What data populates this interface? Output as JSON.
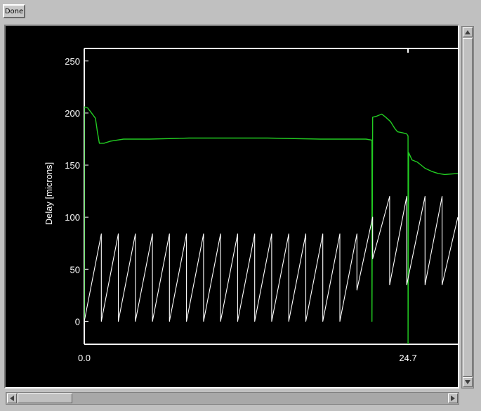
{
  "toolbar": {
    "done_label": "Done"
  },
  "colors": {
    "plot_bg": "#000000",
    "axis": "#ffffff",
    "green_series": "#22cc22",
    "white_series": "#ffffff"
  },
  "chart_data": {
    "type": "line",
    "ylabel": "Delay [microns]",
    "xlabel": "",
    "title": "",
    "ylim": [
      -22,
      262
    ],
    "yticks": [
      0,
      50,
      100,
      150,
      200,
      250
    ],
    "ytick_labels": [
      "0",
      "50",
      "100",
      "150",
      "200",
      "250"
    ],
    "xlim": [
      0,
      28.5
    ],
    "xtick_labels": [
      {
        "x": 0,
        "label": "0.0"
      },
      {
        "x": 24.7,
        "label": "24.7"
      }
    ],
    "grid": false,
    "legend": "none",
    "series": [
      {
        "color": "#22cc22",
        "points": [
          [
            0.0,
            0
          ],
          [
            0.0,
            206
          ],
          [
            0.25,
            205
          ],
          [
            0.5,
            201
          ],
          [
            0.85,
            195
          ],
          [
            1.0,
            182
          ],
          [
            1.15,
            171
          ],
          [
            1.5,
            171
          ],
          [
            2.0,
            173
          ],
          [
            3.0,
            175
          ],
          [
            5.0,
            175
          ],
          [
            8.0,
            176
          ],
          [
            11.0,
            176
          ],
          [
            14.0,
            176
          ],
          [
            18.0,
            175
          ],
          [
            21.5,
            175
          ],
          [
            21.95,
            174
          ],
          [
            21.95,
            0
          ],
          [
            22.0,
            196
          ],
          [
            22.3,
            197
          ],
          [
            22.7,
            199
          ],
          [
            23.0,
            196
          ],
          [
            23.35,
            192
          ],
          [
            23.7,
            185
          ],
          [
            23.9,
            182
          ],
          [
            24.3,
            181
          ],
          [
            24.6,
            180
          ],
          [
            24.7,
            178
          ],
          [
            24.7,
            -22
          ],
          [
            24.75,
            162
          ],
          [
            25.0,
            155
          ],
          [
            25.4,
            153
          ],
          [
            25.7,
            150
          ],
          [
            26.0,
            147
          ],
          [
            26.5,
            144
          ],
          [
            27.0,
            142
          ],
          [
            27.5,
            141
          ],
          [
            28.5,
            142
          ]
        ]
      },
      {
        "color": "#ffffff",
        "points": [
          [
            0.0,
            0
          ],
          [
            1.3,
            84
          ],
          [
            1.3,
            0
          ],
          [
            2.6,
            84
          ],
          [
            2.6,
            0
          ],
          [
            3.9,
            84
          ],
          [
            3.9,
            0
          ],
          [
            5.2,
            84
          ],
          [
            5.2,
            0
          ],
          [
            6.5,
            84
          ],
          [
            6.5,
            0
          ],
          [
            7.8,
            84
          ],
          [
            7.8,
            0
          ],
          [
            9.1,
            84
          ],
          [
            9.1,
            0
          ],
          [
            10.4,
            84
          ],
          [
            10.4,
            0
          ],
          [
            11.7,
            84
          ],
          [
            11.7,
            0
          ],
          [
            13.0,
            84
          ],
          [
            13.0,
            0
          ],
          [
            14.3,
            84
          ],
          [
            14.3,
            0
          ],
          [
            15.6,
            84
          ],
          [
            15.6,
            0
          ],
          [
            16.9,
            84
          ],
          [
            16.9,
            0
          ],
          [
            18.2,
            84
          ],
          [
            18.2,
            0
          ],
          [
            19.5,
            84
          ],
          [
            19.5,
            0
          ],
          [
            20.8,
            84
          ],
          [
            20.8,
            30
          ],
          [
            22.0,
            100
          ],
          [
            22.0,
            60
          ],
          [
            23.3,
            120
          ],
          [
            23.3,
            35
          ],
          [
            24.6,
            120
          ],
          [
            24.6,
            35
          ],
          [
            26.0,
            120
          ],
          [
            26.0,
            35
          ],
          [
            27.3,
            120
          ],
          [
            27.3,
            35
          ],
          [
            28.5,
            100
          ]
        ]
      }
    ]
  }
}
